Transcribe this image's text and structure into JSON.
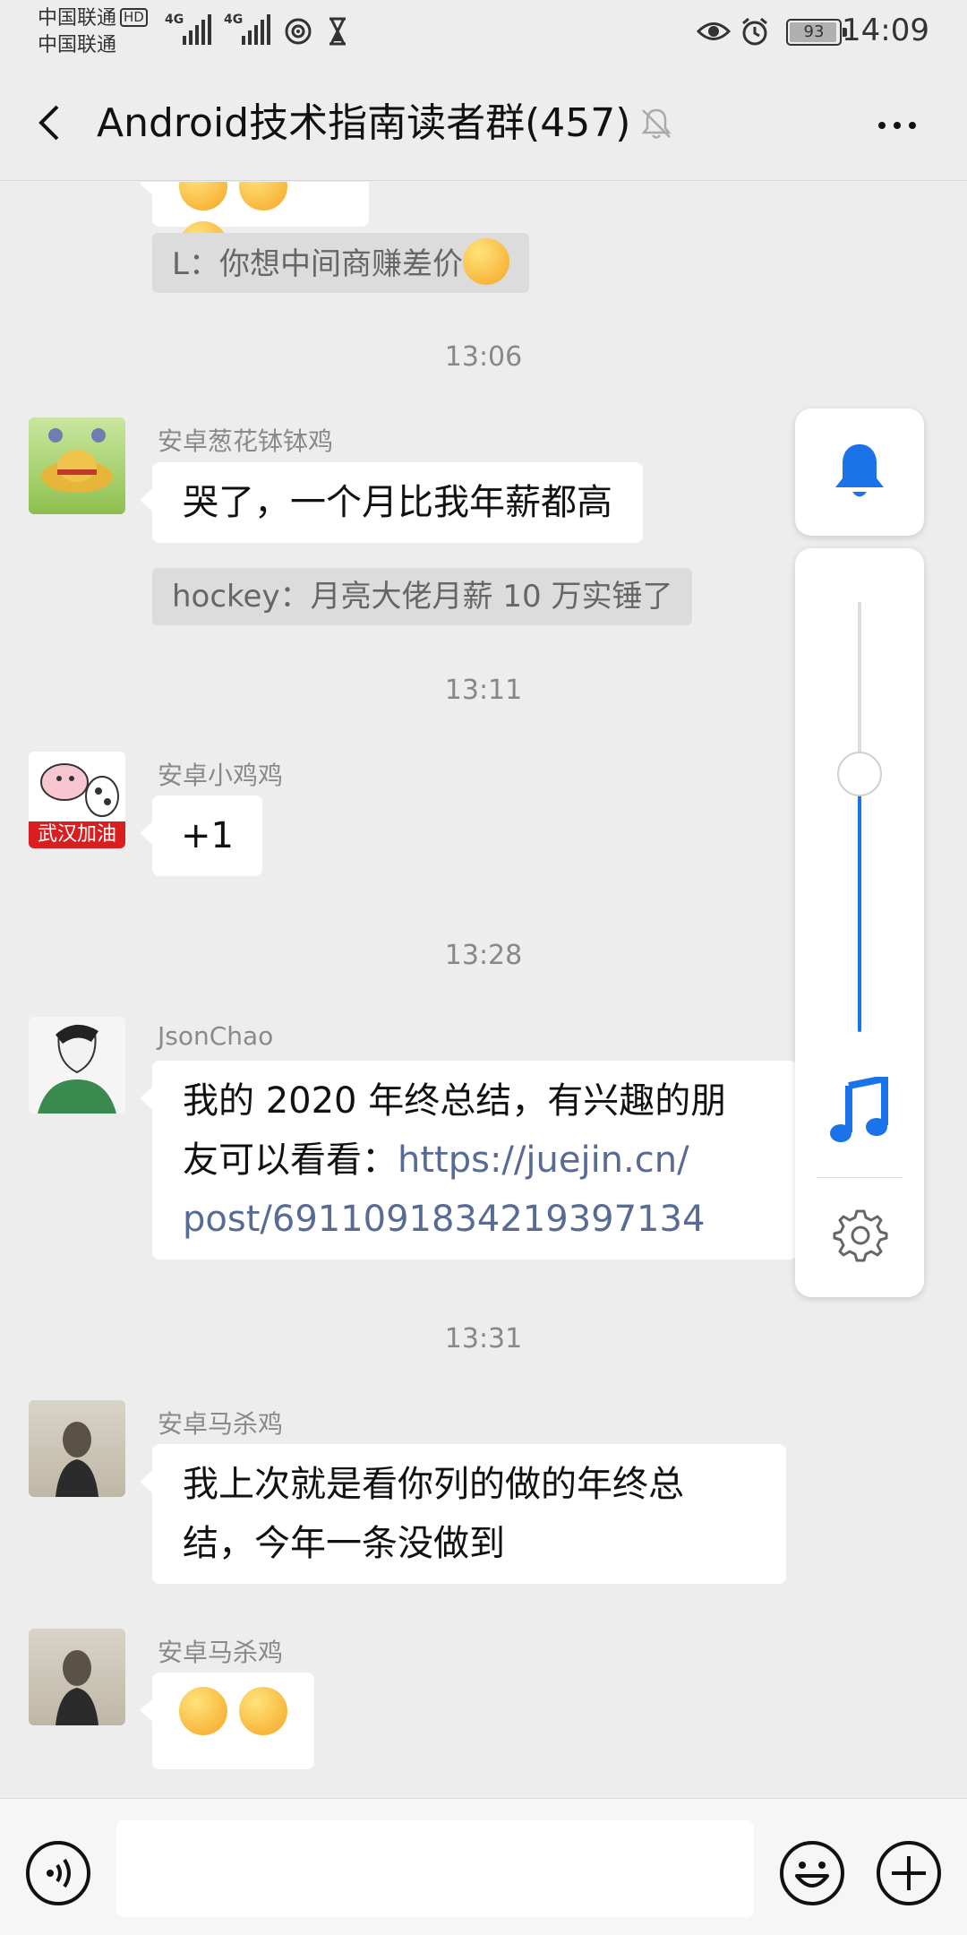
{
  "status_bar": {
    "carrier_1": "中国联通",
    "carrier_2": "中国联通",
    "hd_badge": "HD",
    "network_1": "4G",
    "network_2": "4G",
    "battery": "93",
    "time": "14:09"
  },
  "header": {
    "title": "Android技术指南读者群(457)"
  },
  "messages": {
    "quote_1": "L：你想中间商赚差价",
    "time_1": "13:06",
    "sender_1": "安卓葱花钵钵鸡",
    "text_1": "哭了，一个月比我年薪都高",
    "quote_2": "hockey：月亮大佬月薪 10 万实锤了",
    "time_2": "13:11",
    "sender_2": "安卓小鸡鸡",
    "text_2": "+1",
    "avatar_2_caption": "武汉加油",
    "time_3": "13:28",
    "sender_3": "JsonChao",
    "text_3_line1": "我的 2020 年终总结，有兴趣的朋",
    "text_3_line2_prefix": "友可以看看：",
    "text_3_link_part1": "https://juejin.cn/",
    "text_3_link_part2": "post/6911091834219397134",
    "time_4": "13:31",
    "sender_4": "安卓马杀鸡",
    "text_4_line1": "我上次就是看你列的做的年终总",
    "text_4_line2": "结，今年一条没做到",
    "sender_5": "安卓马杀鸡"
  },
  "volume_panel": {
    "level": 0.6,
    "accent_color": "#1a73e8",
    "icons": [
      "bell-icon",
      "music-note-icon",
      "gear-icon"
    ]
  },
  "colors": {
    "background": "#ededed",
    "bubble": "#ffffff",
    "link": "#576b95"
  }
}
